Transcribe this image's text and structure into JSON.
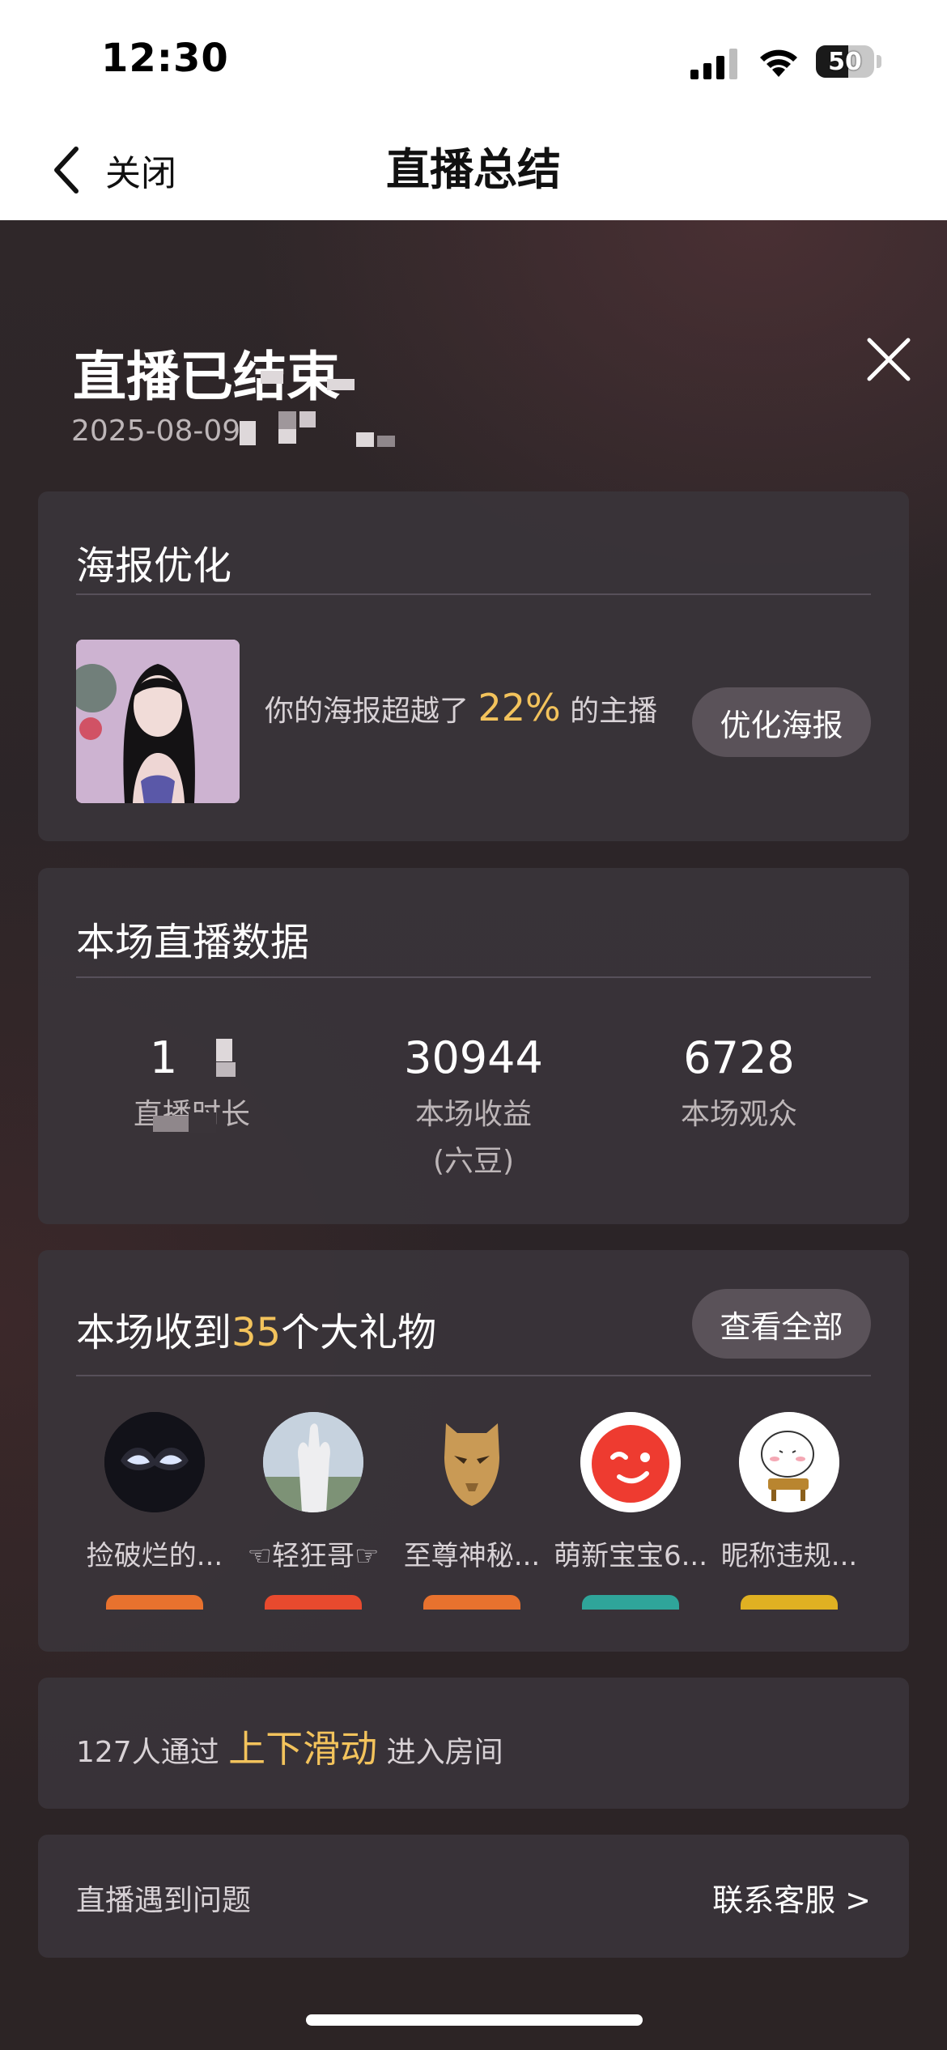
{
  "status_bar": {
    "time": "12:30",
    "battery": "50"
  },
  "nav": {
    "back_label": "关闭",
    "title": "直播总结"
  },
  "summary": {
    "title": "直播已结束",
    "date": "2025-08-09"
  },
  "poster": {
    "title": "海报优化",
    "text_before": "你的海报超越了",
    "percent": "22%",
    "text_after": "的主播",
    "button": "优化海报"
  },
  "live_data": {
    "title": "本场直播数据",
    "stats": [
      {
        "value": "1",
        "label": "直播时长"
      },
      {
        "value": "30944",
        "label": "本场收益",
        "sub": "(六豆)"
      },
      {
        "value": "6728",
        "label": "本场观众"
      }
    ]
  },
  "gifts": {
    "title_before": "本场收到",
    "count": "35",
    "title_after": "个大礼物",
    "view_all": "查看全部",
    "items": [
      {
        "name": "捡破烂的..."
      },
      {
        "name": "☜轻狂哥☞"
      },
      {
        "name": "至尊神秘..."
      },
      {
        "name": "萌新宝宝6..."
      },
      {
        "name": "昵称违规..."
      }
    ]
  },
  "swipe": {
    "count_text": "127人通过",
    "highlight": "上下滑动",
    "after": "进入房间"
  },
  "help": {
    "text": "直播遇到问题",
    "link": "联系客服 >"
  },
  "colors": {
    "accent": "#f3c35c",
    "card": "#3a3439",
    "page": "#2e2729"
  }
}
